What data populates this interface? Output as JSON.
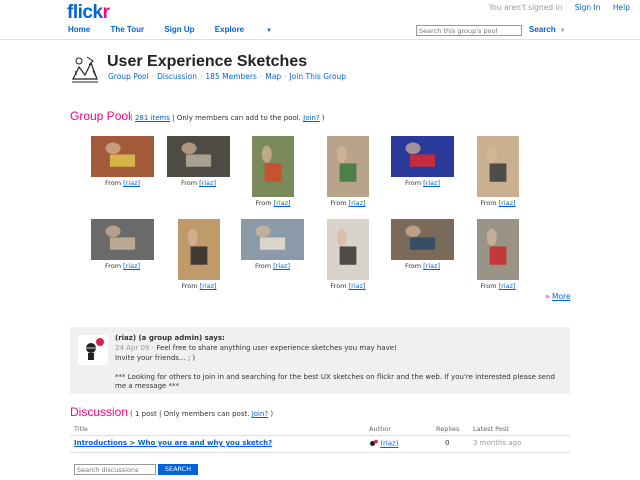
{
  "header": {
    "logo": "flickr",
    "not_signed_in": "You aren't signed in",
    "sign_in": "Sign In",
    "help": "Help",
    "nav": [
      "Home",
      "The Tour",
      "Sign Up",
      "Explore"
    ],
    "search_placeholder": "Search this group's pool",
    "search_label": "Search"
  },
  "group": {
    "title": "User Experience Sketches",
    "nav": [
      "Group Pool",
      "Discussion",
      "185 Members",
      "Map",
      "Join This Group"
    ]
  },
  "pool": {
    "heading": "Group Pool",
    "paren_open": "(",
    "items_link": "281 items",
    "separator": "|",
    "members_only": "Only members can add to the pool.",
    "join": "Join?",
    "paren_close": ")",
    "from_label": "From",
    "photos": [
      {
        "owner": "[riaz]",
        "color": "#a35a3a",
        "accent": "#e0c34a"
      },
      {
        "owner": "[riaz]",
        "color": "#4e4a44",
        "accent": "#b8b0a0"
      },
      {
        "owner": "[riaz]",
        "color": "#7a8a5a",
        "accent": "#d14a2a"
      },
      {
        "owner": "[riaz]",
        "color": "#b9a38a",
        "accent": "#3a7a3a"
      },
      {
        "owner": "[riaz]",
        "color": "#2a3a9a",
        "accent": "#e02a2a"
      },
      {
        "owner": "[riaz]",
        "color": "#c8b090",
        "accent": "#3a3a3a"
      },
      {
        "owner": "[riaz]",
        "color": "#6a6a68",
        "accent": "#c8b49a"
      },
      {
        "owner": "[riaz]",
        "color": "#c09a6a",
        "accent": "#2a2a2a"
      },
      {
        "owner": "[riaz]",
        "color": "#8a9aa8",
        "accent": "#e8e0d0"
      },
      {
        "owner": "[riaz]",
        "color": "#d8d4cc",
        "accent": "#3a3030"
      },
      {
        "owner": "[riaz]",
        "color": "#7a6a5a",
        "accent": "#2a4a6a"
      },
      {
        "owner": "[riaz]",
        "color": "#9a9488",
        "accent": "#c82a2a"
      }
    ],
    "more": "More"
  },
  "admin_post": {
    "says": "(riaz) (a group admin) says:",
    "date": "24 Apr 09 -",
    "line1": "Feel free to share anything user experience sketches you may have!",
    "line2": "Invite your friends... ; )",
    "line3": "*** Looking for others to join in and searching for the best UX sketches on flickr and the web. If you're interested please send me a message ***"
  },
  "discussion": {
    "heading": "Discussion",
    "paren_open": "(",
    "count": "1 post",
    "separator": "|",
    "members_only": "Only members can post.",
    "join": "Join?",
    "paren_close": ")",
    "columns": [
      "Title",
      "Author",
      "Replies",
      "Latest Post"
    ],
    "rows": [
      {
        "title": "Introductions > Who you are and why you sketch?",
        "author": "(riaz)",
        "replies": "0",
        "latest": "3 months ago"
      }
    ],
    "search_placeholder": "Search discussions",
    "search_button": "SEARCH"
  }
}
